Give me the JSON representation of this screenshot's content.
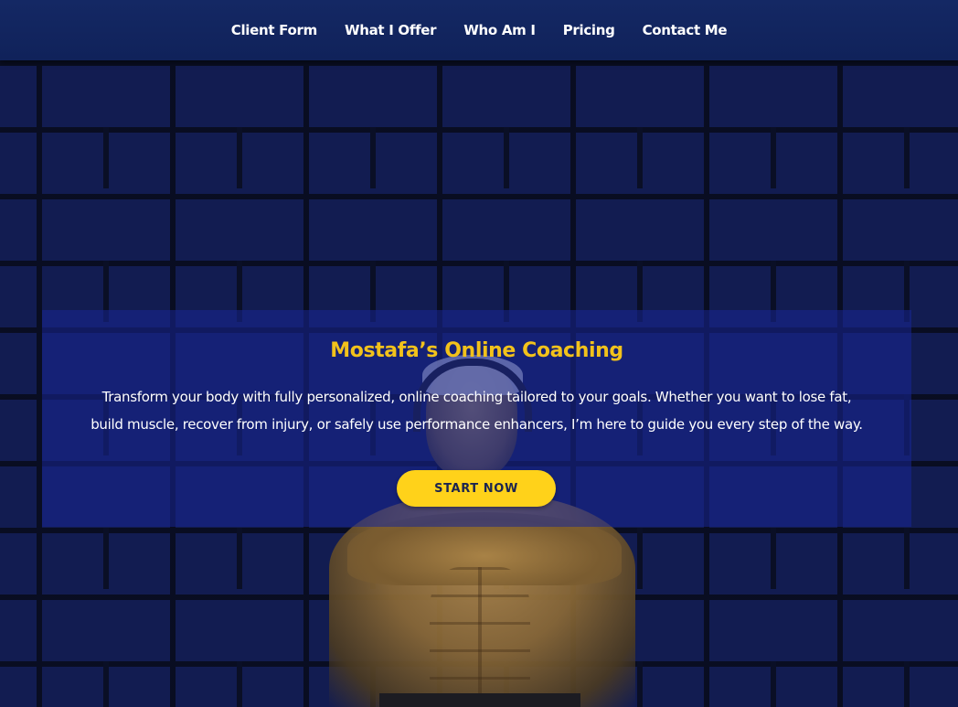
{
  "nav": {
    "items": [
      {
        "label": "Client Form"
      },
      {
        "label": "What I Offer"
      },
      {
        "label": "Who Am I"
      },
      {
        "label": "Pricing"
      },
      {
        "label": "Contact Me"
      }
    ]
  },
  "hero": {
    "title": "Mostafa’s Online Coaching",
    "description": "Transform your body with fully personalized, online coaching tailored to your goals. Whether you want to lose fat, build muscle, recover from injury, or safely use performance enhancers, I’m here to guide you every step of the way.",
    "cta_label": "START NOW"
  },
  "colors": {
    "nav_background": "#142864",
    "title_accent": "#f2c21b",
    "button_background": "#ffd21a",
    "button_text": "#1b2450",
    "overlay": "#1826a0"
  }
}
